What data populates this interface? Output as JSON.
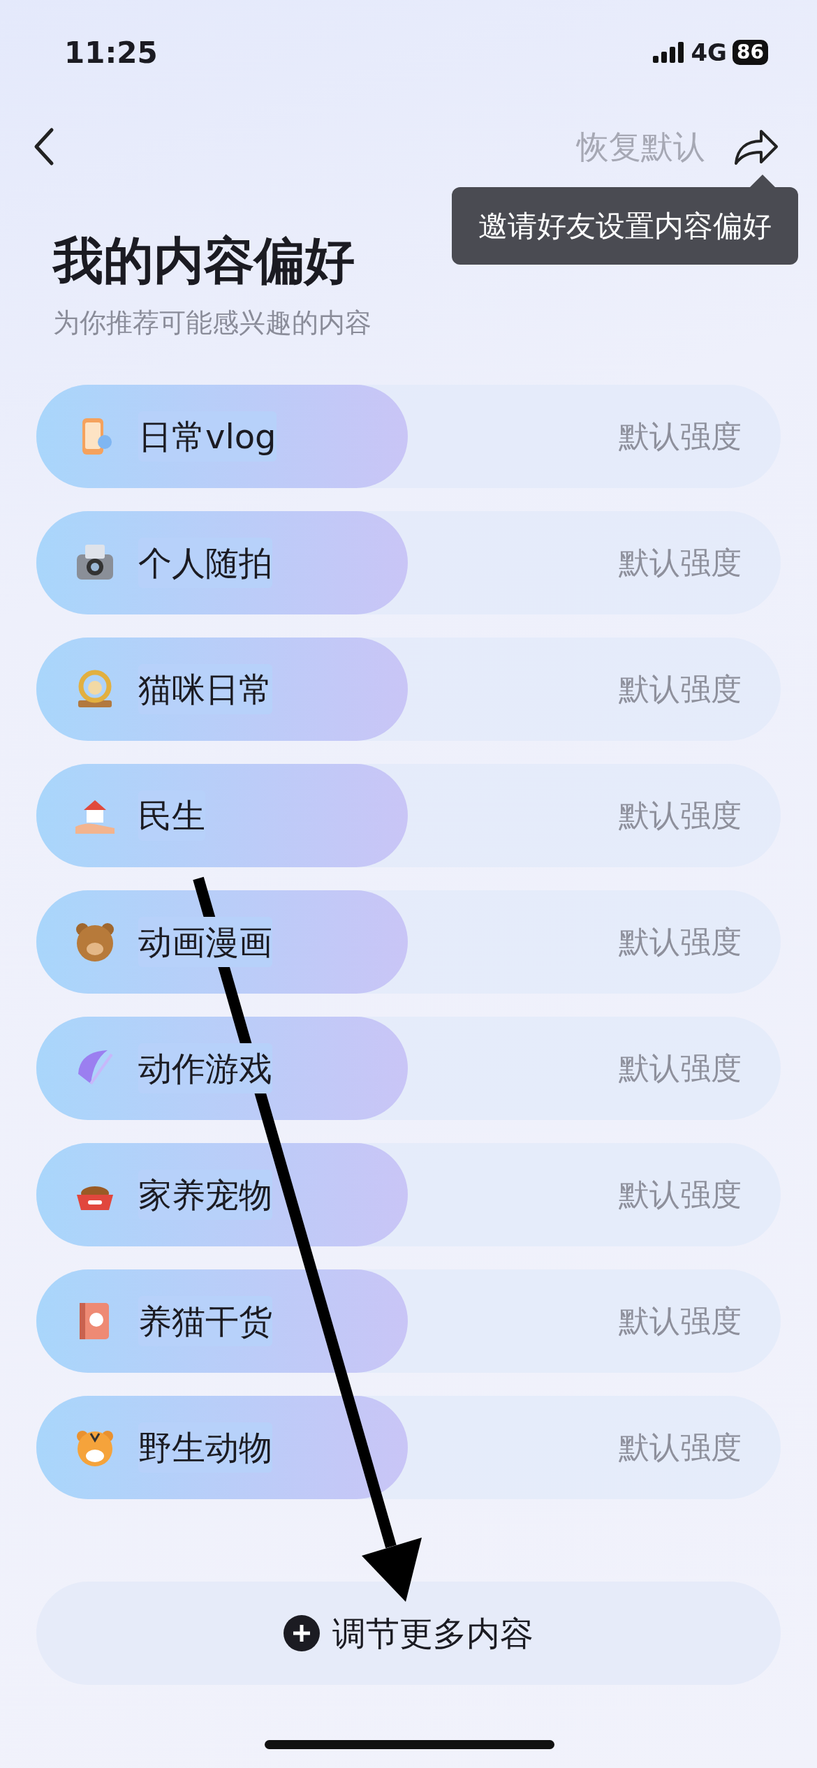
{
  "status_bar": {
    "time": "11:25",
    "network": "4G",
    "battery": "86"
  },
  "header": {
    "reset": "恢复默认",
    "tooltip": "邀请好友设置内容偏好"
  },
  "title": "我的内容偏好",
  "subtitle": "为你推荐可能感兴趣的内容",
  "preferences": [
    {
      "label": "日常vlog",
      "strength": "默认强度"
    },
    {
      "label": "个人随拍",
      "strength": "默认强度"
    },
    {
      "label": "猫咪日常",
      "strength": "默认强度"
    },
    {
      "label": "民生",
      "strength": "默认强度"
    },
    {
      "label": "动画漫画",
      "strength": "默认强度"
    },
    {
      "label": "动作游戏",
      "strength": "默认强度"
    },
    {
      "label": "家养宠物",
      "strength": "默认强度"
    },
    {
      "label": "养猫干货",
      "strength": "默认强度"
    },
    {
      "label": "野生动物",
      "strength": "默认强度"
    }
  ],
  "more_button": {
    "label": "调节更多内容"
  }
}
